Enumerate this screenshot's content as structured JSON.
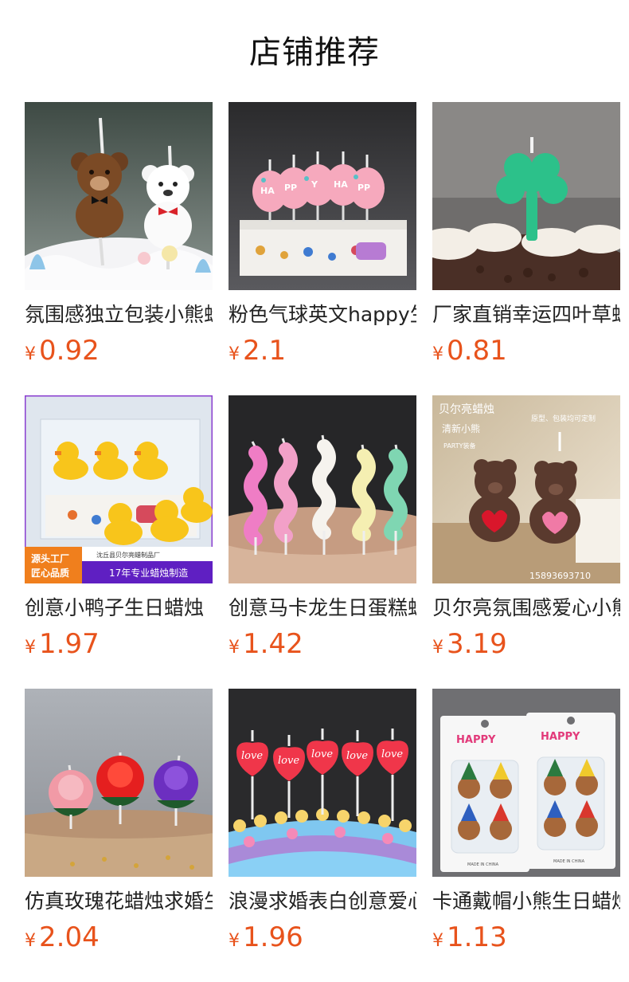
{
  "section_title": "店铺推荐",
  "colors": {
    "price": "#e8531c",
    "title": "#111111",
    "name": "#222222"
  },
  "products": [
    {
      "name": "氛围感独立包装小熊蜡烛",
      "currency": "¥",
      "price": "0.92",
      "image": "bear-candles-on-cake"
    },
    {
      "name": "粉色气球英文happy生日蜡烛",
      "currency": "¥",
      "price": "2.1",
      "image": "pink-balloon-happy-candles"
    },
    {
      "name": "厂家直销幸运四叶草蜡烛",
      "currency": "¥",
      "price": "0.81",
      "image": "green-clover-candle"
    },
    {
      "name": "创意小鸭子生日蜡烛",
      "currency": "¥",
      "price": "1.97",
      "image": "yellow-duck-candles",
      "badge_line1": "源头工厂",
      "badge_line2": "匠心品质",
      "banner_top": "沈丘县贝尔亮蜡制品厂",
      "banner_main": "17年专业蜡烛制造"
    },
    {
      "name": "创意马卡龙生日蛋糕蜡烛",
      "currency": "¥",
      "price": "1.42",
      "image": "macaron-wave-candles"
    },
    {
      "name": "贝尔亮氛围感爱心小熊蜡烛",
      "currency": "¥",
      "price": "3.19",
      "image": "heart-bear-candles",
      "brand": "贝尔亮蜡烛",
      "sub": "清新小熊",
      "tag": "PARTY装备",
      "corner_note": "原型、包装均可定制",
      "phone": "15893693710"
    },
    {
      "name": "仿真玫瑰花蜡烛求婚生日",
      "currency": "¥",
      "price": "2.04",
      "image": "rose-candles"
    },
    {
      "name": "浪漫求婚表白创意爱心蜡烛",
      "currency": "¥",
      "price": "1.96",
      "image": "love-heart-candles"
    },
    {
      "name": "卡通戴帽小熊生日蜡烛",
      "currency": "¥",
      "price": "1.13",
      "image": "party-hat-bear-candles",
      "pack_label": "HAPPY",
      "made_in": "MADE IN CHINA"
    }
  ]
}
